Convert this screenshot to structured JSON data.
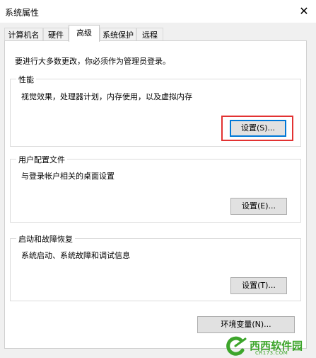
{
  "window": {
    "title": "系统属性"
  },
  "tabs": [
    {
      "label": "计算机名"
    },
    {
      "label": "硬件"
    },
    {
      "label": "高级"
    },
    {
      "label": "系统保护"
    },
    {
      "label": "远程"
    }
  ],
  "notice": "要进行大多数更改，你必须作为管理员登录。",
  "performance": {
    "title": "性能",
    "description": "视觉效果，处理器计划，内存使用，以及虚拟内存",
    "button": "设置(S)..."
  },
  "user_profiles": {
    "title": "用户配置文件",
    "description": "与登录帐户相关的桌面设置",
    "button": "设置(E)..."
  },
  "startup_recovery": {
    "title": "启动和故障恢复",
    "description": "系统启动、系统故障和调试信息",
    "button": "设置(T)..."
  },
  "env_button": "环境变量(N)...",
  "watermark": {
    "text": "西西软件园",
    "sub": "CR173.COM"
  },
  "colors": {
    "highlight": "#e23232",
    "watermark": "#3da52b",
    "focus": "#0078d7"
  }
}
